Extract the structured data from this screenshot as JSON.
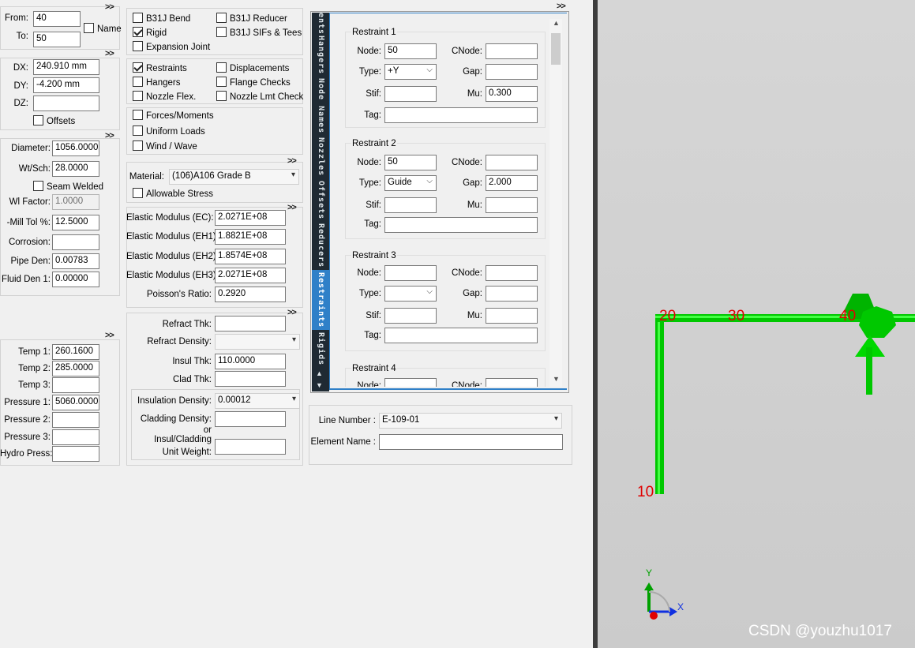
{
  "node_range": {
    "from_label": "From:",
    "from_value": "40",
    "to_label": "To:",
    "to_value": "50",
    "name_label": "Name"
  },
  "deltas": {
    "dx_label": "DX:",
    "dx_value": "240.910 mm",
    "dy_label": "DY:",
    "dy_value": "-4.200 mm",
    "dz_label": "DZ:",
    "dz_value": "",
    "offsets_label": "Offsets"
  },
  "pipe": {
    "diameter_label": "Diameter:",
    "diameter_value": "1056.0000",
    "wtsch_label": "Wt/Sch:",
    "wtsch_value": "28.0000",
    "seam_label": "Seam Welded",
    "wl_label": "Wl Factor:",
    "wl_value": "1.0000",
    "mill_label": "-Mill Tol %:",
    "mill_value": "12.5000",
    "corrosion_label": "Corrosion:",
    "corrosion_value": "",
    "pipeden_label": "Pipe Den:",
    "pipeden_value": "0.00783",
    "fluid_label": "Fluid Den 1:",
    "fluid_value": "0.00000"
  },
  "operating": {
    "temp1_label": "Temp 1:",
    "temp1_value": "260.1600",
    "temp2_label": "Temp 2:",
    "temp2_value": "285.0000",
    "temp3_label": "Temp 3:",
    "temp3_value": "",
    "press1_label": "Pressure 1:",
    "press1_value": "5060.0000",
    "press2_label": "Pressure 2:",
    "press2_value": "",
    "press3_label": "Pressure 3:",
    "press3_value": "",
    "hydro_label": "Hydro Press:",
    "hydro_value": ""
  },
  "expand_glyph": ">>",
  "checks_a": {
    "bend": "B31J Bend",
    "reducer": "B31J Reducer",
    "rigid": "Rigid",
    "sifs": "B31J SIFs & Tees",
    "expansion": "Expansion Joint"
  },
  "checks_b": {
    "restraints": "Restraints",
    "displacements": "Displacements",
    "hangers": "Hangers",
    "flange": "Flange Checks",
    "nozzle_flex": "Nozzle Flex.",
    "nozzle_lmt": "Nozzle Lmt Check"
  },
  "checks_c": {
    "forces": "Forces/Moments",
    "uniform": "Uniform Loads",
    "wind": "Wind / Wave"
  },
  "material": {
    "label": "Material:",
    "value": "(106)A106 Grade B",
    "allowable_label": "Allowable Stress"
  },
  "elastic": {
    "ec_label": "Elastic Modulus (EC):",
    "ec_value": "2.0271E+08",
    "eh1_label": "Elastic Modulus (EH1):",
    "eh1_value": "1.8821E+08",
    "eh2_label": "Elastic Modulus (EH2):",
    "eh2_value": "1.8574E+08",
    "eh3_label": "Elastic Modulus (EH3):",
    "eh3_value": "2.0271E+08",
    "poisson_label": "Poisson's Ratio:",
    "poisson_value": "0.2920"
  },
  "insulation": {
    "refract_thk_label": "Refract Thk:",
    "refract_thk_value": "",
    "refract_den_label": "Refract Density:",
    "refract_den_value": "",
    "insul_thk_label": "Insul Thk:",
    "insul_thk_value": "110.0000",
    "clad_thk_label": "Clad Thk:",
    "clad_thk_value": "",
    "insul_den_label": "Insulation Density:",
    "insul_den_value": "0.00012",
    "clad_den_label": "Cladding Density:",
    "clad_den_value": "",
    "or_label": "or",
    "unit_wt_label1": "Insul/Cladding",
    "unit_wt_label2": "Unit Weight:",
    "unit_wt_value": ""
  },
  "tabs": {
    "items": [
      "ents",
      "Hangers",
      "Node Names",
      "Nozzles",
      "Offsets",
      "Reducers",
      "Restraints",
      "Rigids"
    ],
    "active": "Restraints",
    "scroll_up": "▲",
    "scroll_down": "▼"
  },
  "restraints": {
    "node_label": "Node:",
    "cnode_label": "CNode:",
    "type_label": "Type:",
    "gap_label": "Gap:",
    "stif_label": "Stif:",
    "mu_label": "Mu:",
    "tag_label": "Tag:",
    "items": [
      {
        "title": "Restraint 1",
        "node": "50",
        "cnode": "",
        "type": "+Y",
        "gap": "",
        "stif": "",
        "mu": "0.300",
        "tag": ""
      },
      {
        "title": "Restraint 2",
        "node": "50",
        "cnode": "",
        "type": "Guide",
        "gap": "2.000",
        "stif": "",
        "mu": "",
        "tag": ""
      },
      {
        "title": "Restraint 3",
        "node": "",
        "cnode": "",
        "type": "",
        "gap": "",
        "stif": "",
        "mu": "",
        "tag": ""
      },
      {
        "title": "Restraint 4",
        "node": "",
        "cnode": "",
        "type": ""
      }
    ]
  },
  "line": {
    "line_number_label": "Line Number :",
    "line_number_value": "E-109-01",
    "element_name_label": "Element Name :",
    "element_name_value": ""
  },
  "view3d": {
    "node_labels": [
      "20",
      "30",
      "40",
      "10"
    ],
    "axis_y": "Y",
    "axis_x": "X",
    "watermark": "CSDN @youzhu1017",
    "pipe_color": "#00dd00",
    "label_color": "#e00000"
  }
}
